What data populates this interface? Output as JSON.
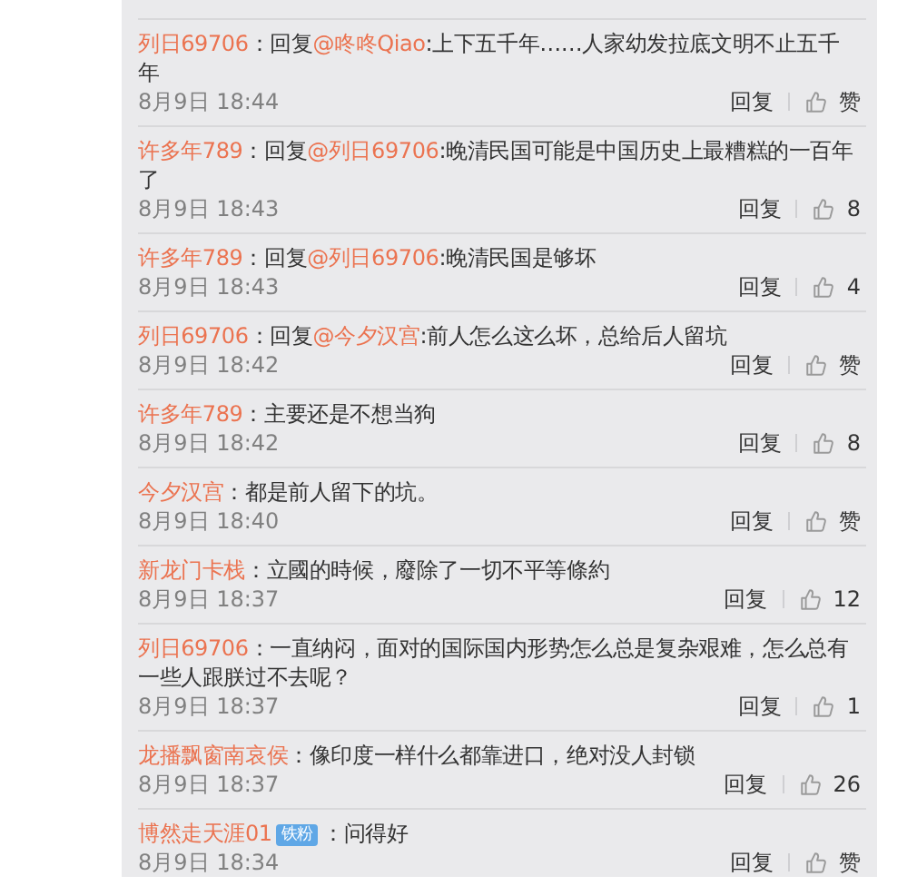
{
  "comments": [
    {
      "author": "列日69706",
      "sep": "：",
      "reply": "回复",
      "mention": "@咚咚Qiao",
      "text": ":上下五千年……人家幼发拉底文明不止五千年",
      "time": "8月9日 18:44",
      "reply_button": "回复",
      "like": "赞"
    },
    {
      "author": "许多年789",
      "sep": "：",
      "reply": "回复",
      "mention": "@列日69706",
      "text": ":晚清民国可能是中国历史上最糟糕的一百年了",
      "time": "8月9日 18:43",
      "reply_button": "回复",
      "like": "8"
    },
    {
      "author": "许多年789",
      "sep": "：",
      "reply": "回复",
      "mention": "@列日69706",
      "text": ":晚清民国是够坏",
      "time": "8月9日 18:43",
      "reply_button": "回复",
      "like": "4"
    },
    {
      "author": "列日69706",
      "sep": "：",
      "reply": "回复",
      "mention": "@今夕汉宫",
      "text": ":前人怎么这么坏，总给后人留坑",
      "time": "8月9日 18:42",
      "reply_button": "回复",
      "like": "赞"
    },
    {
      "author": "许多年789",
      "sep": "：",
      "text": "主要还是不想当狗",
      "time": "8月9日 18:42",
      "reply_button": "回复",
      "like": "8"
    },
    {
      "author": "今夕汉宫",
      "sep": "：",
      "text": "都是前人留下的坑。",
      "time": "8月9日 18:40",
      "reply_button": "回复",
      "like": "赞"
    },
    {
      "author": "新龙门卡栈",
      "sep": "：",
      "text": "立國的時候，廢除了一切不平等條約",
      "time": "8月9日 18:37",
      "reply_button": "回复",
      "like": "12"
    },
    {
      "author": "列日69706",
      "sep": "：",
      "text": "一直纳闷，面对的国际国内形势怎么总是复杂艰难，怎么总有一些人跟朕过不去呢？",
      "time": "8月9日 18:37",
      "reply_button": "回复",
      "like": "1"
    },
    {
      "author": "龙播飘窗南哀侯",
      "sep": "：",
      "text": "像印度一样什么都靠进口，绝对没人封锁",
      "time": "8月9日 18:37",
      "reply_button": "回复",
      "like": "26"
    },
    {
      "author": "博然走天涯01",
      "badge": "铁粉",
      "sep": "：",
      "text": "问得好",
      "time": "8月9日 18:34",
      "reply_button": "回复",
      "like": "赞"
    }
  ]
}
